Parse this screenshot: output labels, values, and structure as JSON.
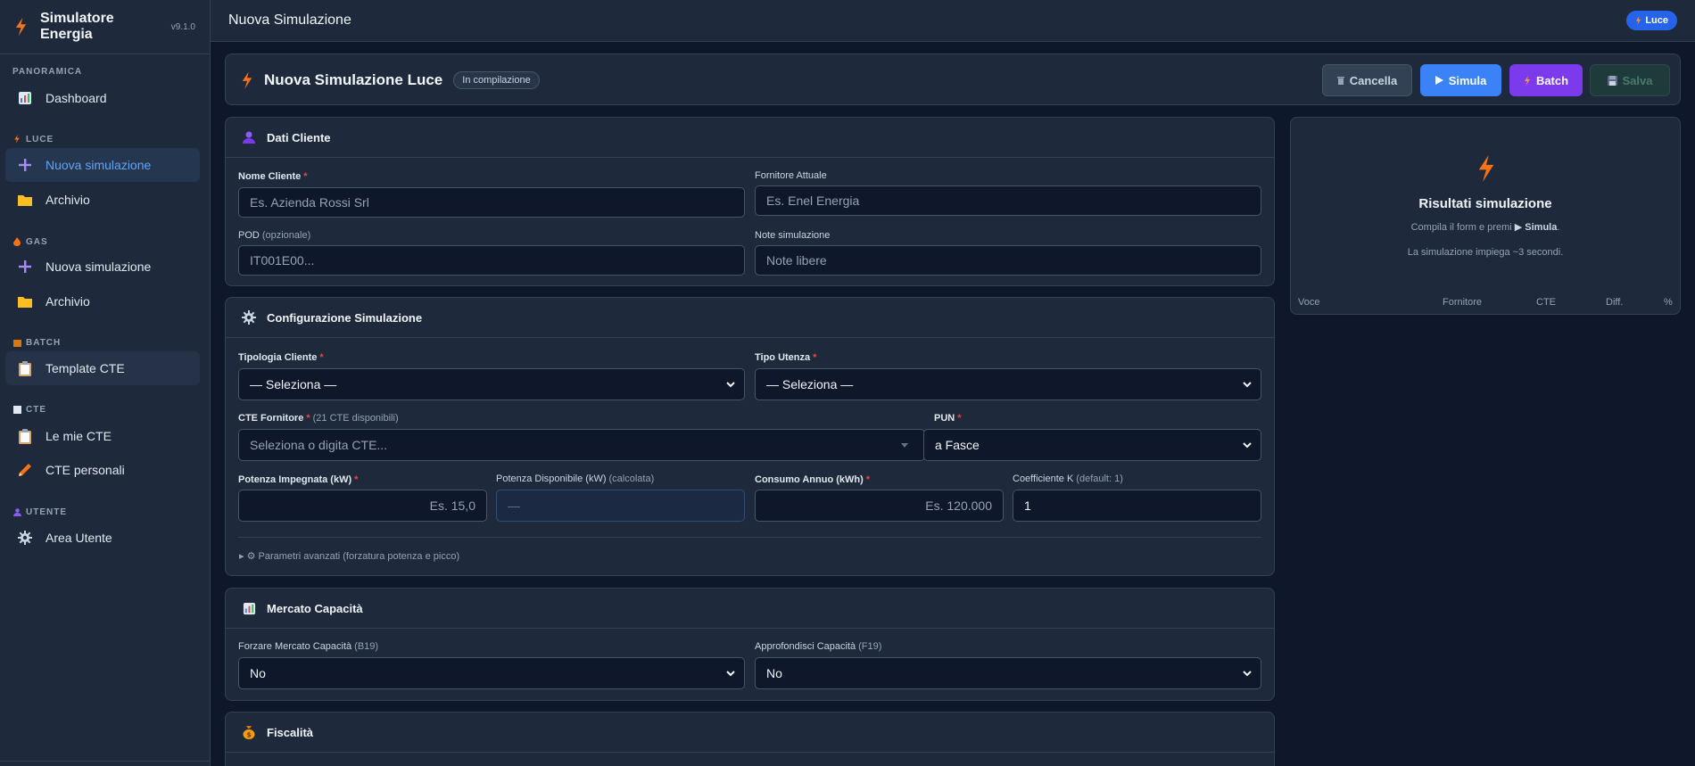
{
  "app": {
    "name": "Simulatore Energia",
    "version": "v9.1.0"
  },
  "topbar": {
    "title": "Nuova Simulazione",
    "badge": "Luce"
  },
  "sidebar": {
    "sections": [
      {
        "label": "PANORAMICA"
      },
      {
        "label": "LUCE"
      },
      {
        "label": "GAS"
      },
      {
        "label": "BATCH"
      },
      {
        "label": "CTE"
      },
      {
        "label": "UTENTE"
      }
    ],
    "items": [
      {
        "label": "Dashboard"
      },
      {
        "label": "Nuova simulazione"
      },
      {
        "label": "Archivio"
      },
      {
        "label": "Nuova simulazione"
      },
      {
        "label": "Archivio"
      },
      {
        "label": "Template CTE"
      },
      {
        "label": "Le mie CTE"
      },
      {
        "label": "CTE personali"
      },
      {
        "label": "Area Utente"
      }
    ]
  },
  "header": {
    "title": "Nuova Simulazione Luce",
    "status": "In compilazione",
    "buttons": {
      "cancel": "Cancella",
      "simulate": "Simula",
      "batch": "Batch",
      "save": "Salva"
    }
  },
  "dati_cliente": {
    "title": "Dati Cliente",
    "nome_label": "Nome Cliente",
    "nome_placeholder": "Es. Azienda Rossi Srl",
    "fornitore_label": "Fornitore Attuale",
    "fornitore_placeholder": "Es. Enel Energia",
    "pod_label": "POD",
    "pod_hint": "(opzionale)",
    "pod_placeholder": "IT001E00...",
    "note_label": "Note simulazione",
    "note_placeholder": "Note libere"
  },
  "configurazione": {
    "title": "Configurazione Simulazione",
    "tipologia_label": "Tipologia Cliente",
    "tipologia_value": "— Seleziona —",
    "utenza_label": "Tipo Utenza",
    "utenza_value": "— Seleziona —",
    "cte_label": "CTE Fornitore",
    "cte_hint": "(21 CTE disponibili)",
    "cte_placeholder": "Seleziona o digita CTE...",
    "pun_label": "PUN",
    "pun_value": "a Fasce",
    "potenza_label": "Potenza Impegnata (kW)",
    "potenza_placeholder": "Es. 15,0",
    "potenza_disp_label": "Potenza Disponibile (kW)",
    "potenza_disp_hint": "(calcolata)",
    "potenza_disp_value": "—",
    "consumo_label": "Consumo Annuo (kWh)",
    "consumo_placeholder": "Es. 120.000",
    "coeff_label": "Coefficiente K",
    "coeff_hint": "(default: 1)",
    "coeff_value": "1",
    "advanced": "▸ ⚙ Parametri avanzati (forzatura potenza e picco)"
  },
  "mercato": {
    "title": "Mercato Capacità",
    "forzare_label": "Forzare Mercato Capacità",
    "forzare_hint": "(B19)",
    "forzare_value": "No",
    "approf_label": "Approfondisci Capacità",
    "approf_hint": "(F19)",
    "approf_value": "No"
  },
  "fiscalita": {
    "title": "Fiscalità"
  },
  "results": {
    "title": "Risultati simulazione",
    "sub_prefix": "Compila il form e premi",
    "sub_action": "▶ Simula",
    "sub_suffix": ".",
    "sub2": "La simulazione impiega ~3 secondi.",
    "columns": [
      "Voce",
      "Fornitore",
      "CTE",
      "Diff.",
      "%"
    ]
  },
  "colors": {
    "accent": "#3b82f6",
    "batch": "#7c3aed",
    "bolt": "#f97316",
    "bg": "#0f172a",
    "panel": "#1e293b"
  }
}
